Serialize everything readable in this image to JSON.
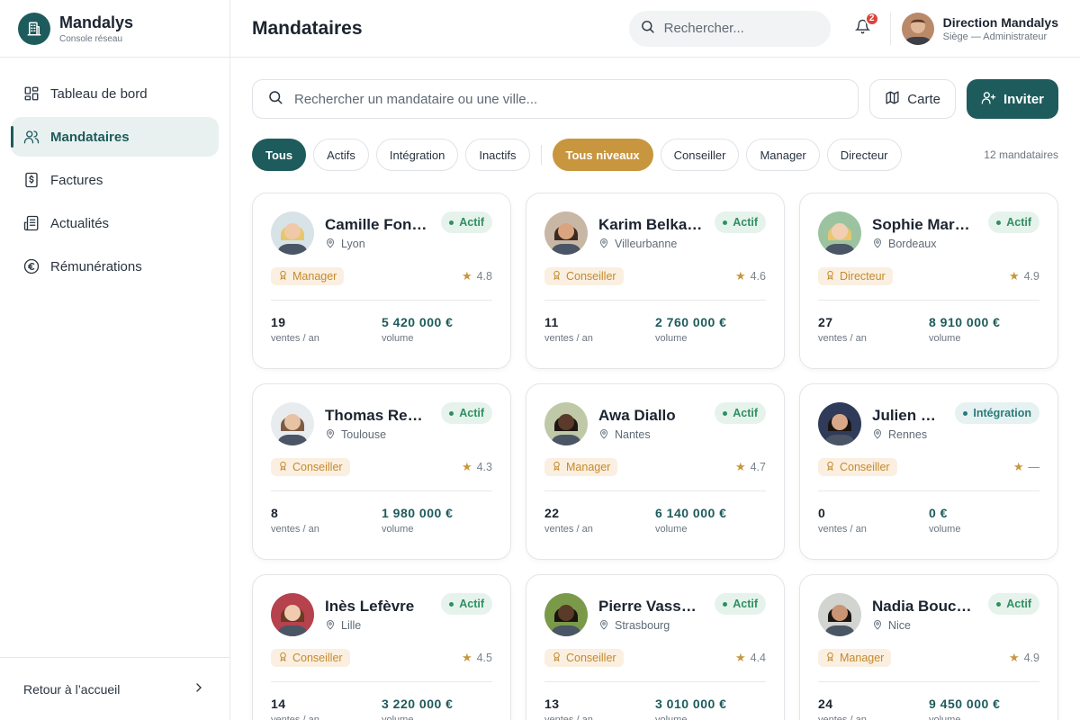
{
  "brand": {
    "name": "Mandalys",
    "subtitle": "Console réseau"
  },
  "sidebar": {
    "items": [
      {
        "label": "Tableau de bord",
        "icon": "dashboard-icon",
        "active": false
      },
      {
        "label": "Mandataires",
        "icon": "users-icon",
        "active": true
      },
      {
        "label": "Factures",
        "icon": "invoice-icon",
        "active": false
      },
      {
        "label": "Actualités",
        "icon": "newspaper-icon",
        "active": false
      },
      {
        "label": "Rémunérations",
        "icon": "euro-icon",
        "active": false
      }
    ],
    "footer_label": "Retour à l’accueil"
  },
  "header": {
    "title": "Mandataires",
    "search_placeholder": "Rechercher...",
    "notifications_count": "2",
    "user_name": "Direction Mandalys",
    "user_role": "Siège — Administrateur"
  },
  "toolbar": {
    "search_placeholder": "Rechercher un mandataire ou une ville...",
    "map_label": "Carte",
    "invite_label": "Inviter"
  },
  "filters": {
    "status": [
      "Tous",
      "Actifs",
      "Intégration",
      "Inactifs"
    ],
    "levels": [
      "Tous niveaux",
      "Conseiller",
      "Manager",
      "Directeur"
    ],
    "count_label": "12 mandataires"
  },
  "cards": [
    {
      "name": "Camille Font…",
      "city": "Lyon",
      "status": "Actif",
      "level": "Manager",
      "rating": "4.8",
      "sales": "19",
      "sales_label": "ventes / an",
      "volume": "5 420 000 €",
      "volume_label": "volume"
    },
    {
      "name": "Karim Belka…",
      "city": "Villeurbanne",
      "status": "Actif",
      "level": "Conseiller",
      "rating": "4.6",
      "sales": "11",
      "sales_label": "ventes / an",
      "volume": "2 760 000 €",
      "volume_label": "volume"
    },
    {
      "name": "Sophie Marc…",
      "city": "Bordeaux",
      "status": "Actif",
      "level": "Directeur",
      "rating": "4.9",
      "sales": "27",
      "sales_label": "ventes / an",
      "volume": "8 910 000 €",
      "volume_label": "volume"
    },
    {
      "name": "Thomas Ren…",
      "city": "Toulouse",
      "status": "Actif",
      "level": "Conseiller",
      "rating": "4.3",
      "sales": "8",
      "sales_label": "ventes / an",
      "volume": "1 980 000 €",
      "volume_label": "volume"
    },
    {
      "name": "Awa Diallo",
      "city": "Nantes",
      "status": "Actif",
      "level": "Manager",
      "rating": "4.7",
      "sales": "22",
      "sales_label": "ventes / an",
      "volume": "6 140 000 €",
      "volume_label": "volume"
    },
    {
      "name": "Julien …",
      "city": "Rennes",
      "status": "Intégration",
      "level": "Conseiller",
      "rating": "—",
      "sales": "0",
      "sales_label": "ventes / an",
      "volume": "0 €",
      "volume_label": "volume"
    },
    {
      "name": "Inès Lefèvre",
      "city": "Lille",
      "status": "Actif",
      "level": "Conseiller",
      "rating": "4.5",
      "sales": "14",
      "sales_label": "ventes / an",
      "volume": "3 220 000 €",
      "volume_label": "volume"
    },
    {
      "name": "Pierre Vasseur",
      "city": "Strasbourg",
      "status": "Actif",
      "level": "Conseiller",
      "rating": "4.4",
      "sales": "13",
      "sales_label": "ventes / an",
      "volume": "3 010 000 €",
      "volume_label": "volume"
    },
    {
      "name": "Nadia Bouch…",
      "city": "Nice",
      "status": "Actif",
      "level": "Manager",
      "rating": "4.9",
      "sales": "24",
      "sales_label": "ventes / an",
      "volume": "9 450 000 €",
      "volume_label": "volume"
    }
  ],
  "colors": {
    "primary": "#1e5b5c",
    "gold": "#c8963e",
    "success": "#2f8f5f",
    "badge": "#d9453d"
  }
}
